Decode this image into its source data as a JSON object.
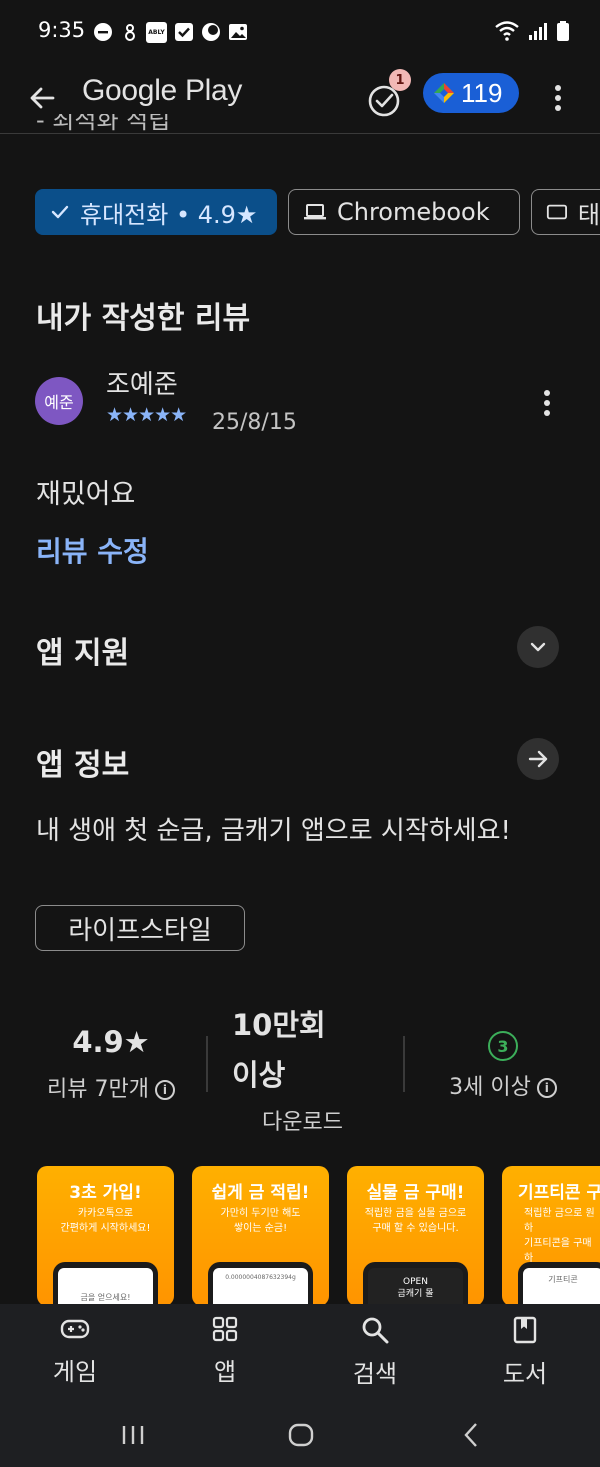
{
  "status_bar": {
    "time": "9:35",
    "app_icon_label": "ABLY"
  },
  "app_bar": {
    "title": "Google Play",
    "notification_count": "1",
    "points": "119"
  },
  "clipped_text": "- 최적화 적립",
  "device_chips": [
    {
      "label": "휴대전화 • 4.9★",
      "selected": true,
      "icon": "check-icon"
    },
    {
      "label": "Chromebook",
      "selected": false,
      "icon": "laptop-icon"
    },
    {
      "label": "태",
      "selected": false,
      "icon": "tablet-icon"
    }
  ],
  "my_review": {
    "heading": "내가 작성한 리뷰",
    "avatar_text": "예준",
    "reviewer_name": "조예준",
    "rating": 5,
    "stars": "★★★★★",
    "date": "25/8/15",
    "text": "재밌어요",
    "edit_label": "리뷰 수정"
  },
  "app_support": {
    "heading": "앱 지원"
  },
  "app_info": {
    "heading": "앱 정보",
    "description": "내 생애 첫 순금, 금캐기 앱으로 시작하세요!",
    "category": "라이프스타일"
  },
  "stats": {
    "rating_value": "4.9★",
    "rating_sub": "리뷰 7만개",
    "downloads_value_line1": "10만회",
    "downloads_value_line2": "이상",
    "downloads_sub": "다운로드",
    "age_badge": "3",
    "age_sub": "3세 이상"
  },
  "screenshots": [
    {
      "title": "3초 가입!",
      "subtitle": "카카오톡으로\n간편하게 시작하세요!",
      "screen": "금을 얻으세요!"
    },
    {
      "title": "쉽게 금 적립!",
      "subtitle": "가만히 두기만 해도\n쌓이는 순금!",
      "screen": "0.0000004087632394g"
    },
    {
      "title": "실물 금 구매!",
      "subtitle": "적립한 금을 실물 금으로\n구매 할 수 있습니다.",
      "screen": "OPEN\n금캐기 몰"
    },
    {
      "title": "기프티콘 구",
      "subtitle": "적립한 금으로 원하\n기프티콘을 구매하",
      "screen": "기프티콘"
    }
  ],
  "bottom_nav": [
    {
      "label": "게임",
      "icon": "gamepad-icon"
    },
    {
      "label": "앱",
      "icon": "apps-grid-icon"
    },
    {
      "label": "검색",
      "icon": "search-icon"
    },
    {
      "label": "도서",
      "icon": "book-icon"
    }
  ],
  "colors": {
    "background": "#141414",
    "accent_blue": "#8ab4f8",
    "selected_chip": "#0b4f8a",
    "points_pill": "#1a5fd6",
    "age_green": "#3cae5a",
    "avatar_purple": "#7e57c2",
    "screenshot_orange": "#ffa000"
  }
}
